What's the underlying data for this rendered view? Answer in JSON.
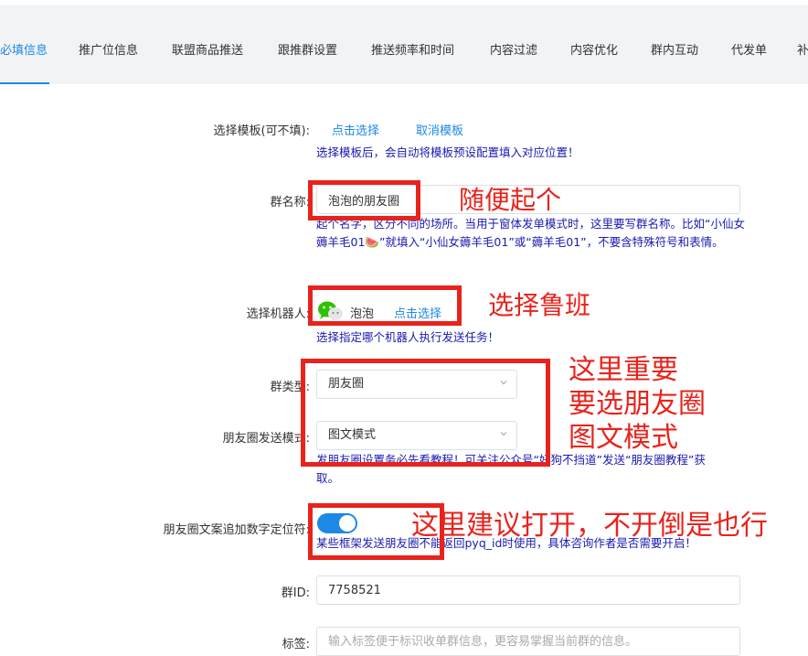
{
  "tabs": [
    {
      "label": "必填信息",
      "active": true
    },
    {
      "label": "推广位信息"
    },
    {
      "label": "联盟商品推送"
    },
    {
      "label": "跟推群设置"
    },
    {
      "label": "推送频率和时间"
    },
    {
      "label": "内容过滤"
    },
    {
      "label": "内容优化"
    },
    {
      "label": "群内互动"
    },
    {
      "label": "代发单"
    },
    {
      "label": "补"
    }
  ],
  "form": {
    "template": {
      "label": "选择模板(可不填):",
      "select_link": "点击选择",
      "cancel_link": "取消模板",
      "hint": "选择模板后，会自动将模板预设配置填入对应位置！"
    },
    "group_name": {
      "label": "群名称:",
      "value": "泡泡的朋友圈",
      "hint": "起个名字，区分不同的场所。当用于窗体发单模式时，这里要写群名称。比如“小仙女薅羊毛01🍉”就填入“小仙女薅羊毛01”或“薅羊毛01”，不要含特殊符号和表情。"
    },
    "robot": {
      "label": "选择机器人:",
      "name": "泡泡",
      "select_link": "点击选择",
      "hint": "选择指定哪个机器人执行发送任务！"
    },
    "group_type": {
      "label": "群类型:",
      "value": "朋友圈"
    },
    "moments_mode": {
      "label": "朋友圈发送模式:",
      "value": "图文模式",
      "hint": "发朋友圈设置务必先看教程！可关注公众号“好狗不挡道”发送“朋友圈教程”获取。"
    },
    "number_locator": {
      "label": "朋友圈文案追加数字定位符:",
      "enabled": true,
      "hint": "某些框架发送朋友圈不能返回pyq_id时使用，具体咨询作者是否需要开启！"
    },
    "group_id": {
      "label": "群ID:",
      "value": "7758521"
    },
    "tags": {
      "label": "标签:",
      "placeholder": "输入标签便于标识收单群信息，更容易掌握当前群的信息。"
    }
  },
  "annotations": {
    "note1": "随便起个",
    "note2": "选择鲁班",
    "note3_line1": "这里重要",
    "note3_line2": "要选朋友圈",
    "note3_line3": "图文模式",
    "note4": "这里建议打开，不开倒是也行"
  },
  "colors": {
    "accent": "#1e88e5",
    "hint": "#1a1ab0",
    "annotation": "#e8231c",
    "wechat": "#2dc100"
  }
}
